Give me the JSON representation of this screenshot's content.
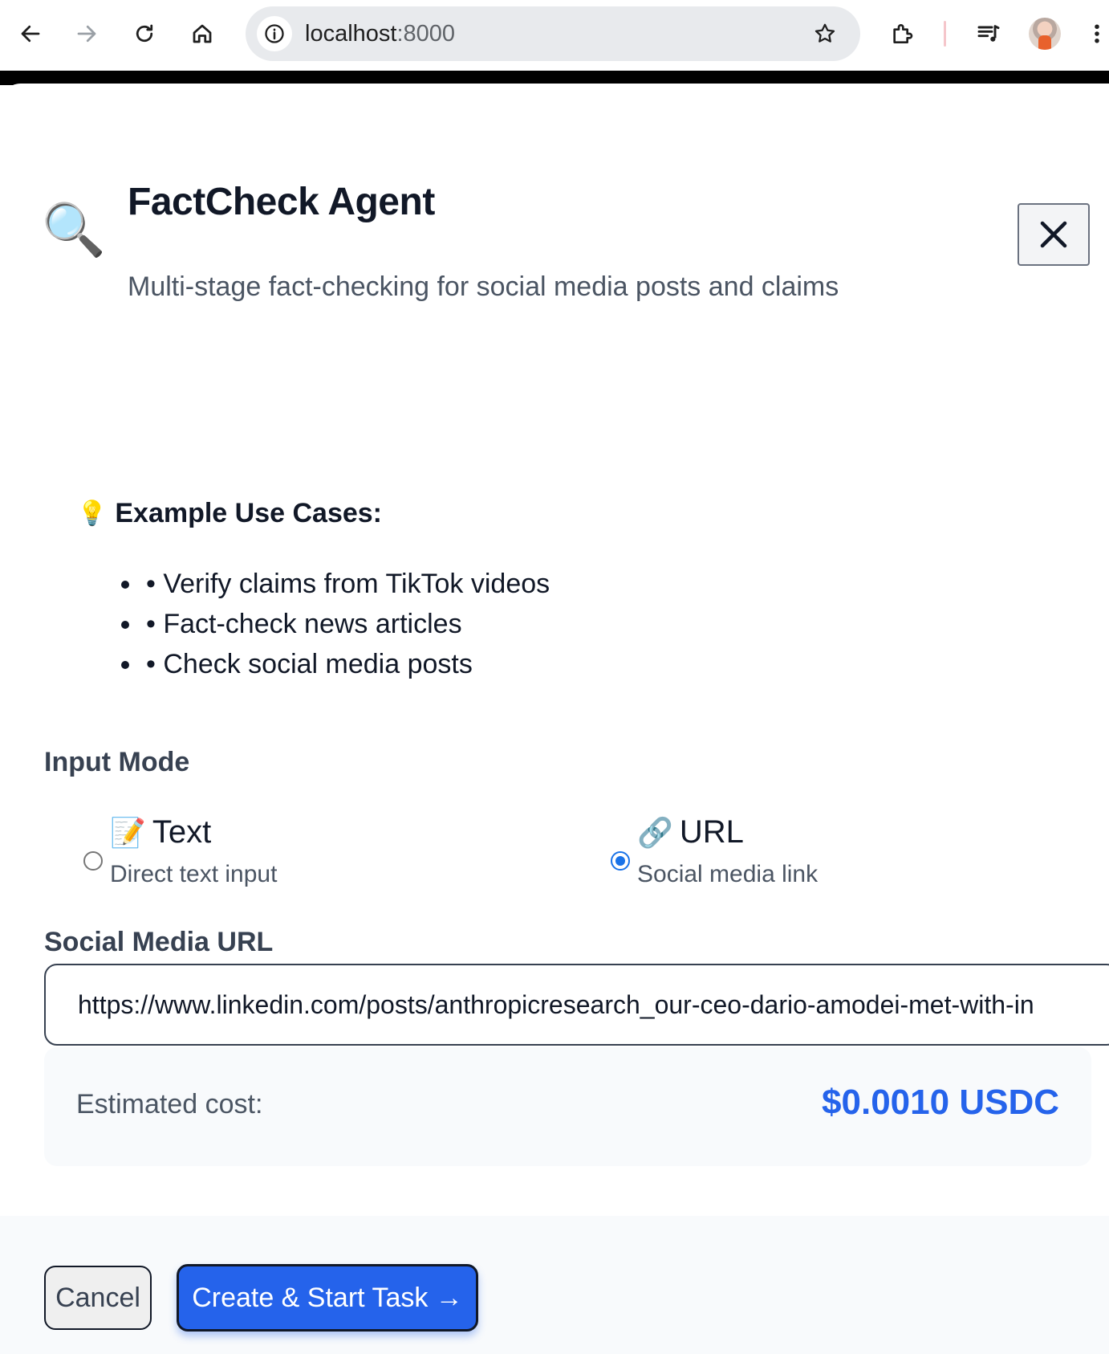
{
  "browser": {
    "url_host": "localhost",
    "url_port": ":8000",
    "icons": [
      "back-icon",
      "forward-icon",
      "reload-icon",
      "home-icon",
      "site-info-icon",
      "bookmark-star-icon",
      "extensions-icon",
      "media-controls-icon",
      "profile-avatar",
      "more-menu-icon"
    ]
  },
  "modal": {
    "icon": "🔍",
    "title": "FactCheck Agent",
    "subtitle": "Multi-stage fact-checking for social media posts and claims",
    "examples_icon": "💡",
    "examples_heading": "Example Use Cases:",
    "examples": [
      "• Verify claims from TikTok videos",
      "• Fact-check news articles",
      "• Check social media posts"
    ],
    "input_mode_label": "Input Mode",
    "modes": [
      {
        "icon": "📝",
        "title": "Text",
        "description": "Direct text input",
        "checked": false
      },
      {
        "icon": "🔗",
        "title": "URL",
        "description": "Social media link",
        "checked": true
      }
    ],
    "url_field_label": "Social Media URL",
    "url_field_value": "https://www.linkedin.com/posts/anthropicresearch_our-ceo-dario-amodei-met-with-in",
    "cost_label": "Estimated cost:",
    "cost_value": "$0.0010 USDC"
  },
  "footer": {
    "cancel_label": "Cancel",
    "submit_label": "Create & Start Task →"
  },
  "colors": {
    "accent": "#2563eb",
    "radio_checked": "#1a73e8",
    "text_muted": "#4b5563"
  }
}
